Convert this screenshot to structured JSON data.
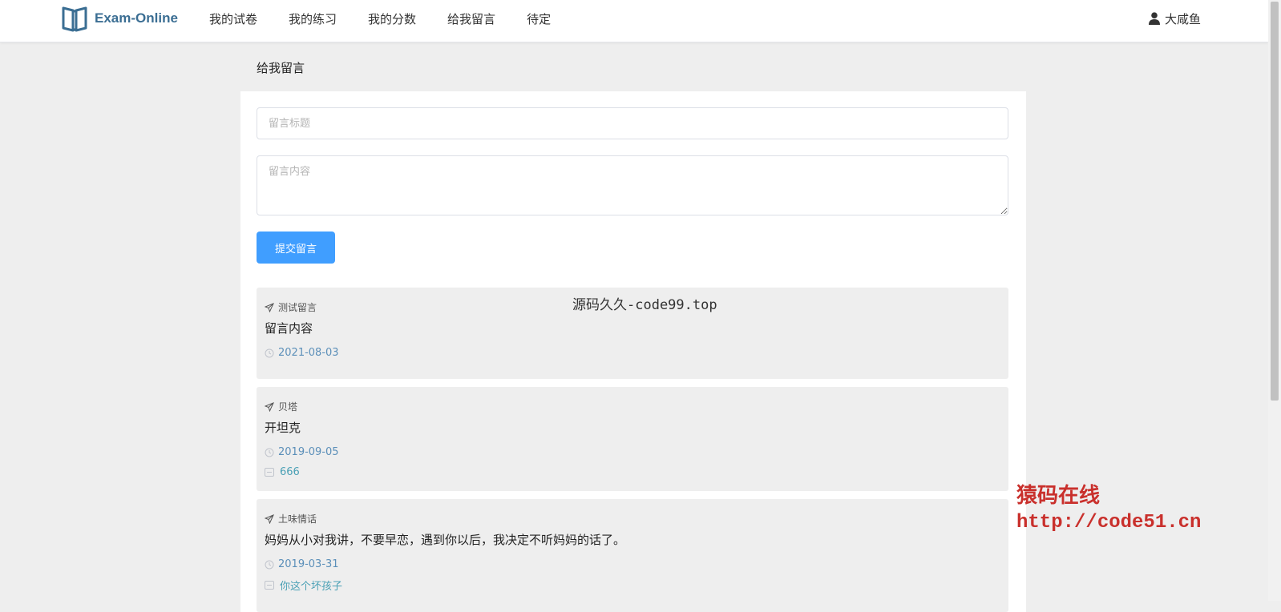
{
  "brand": {
    "name": "Exam-Online",
    "logo_icon": "open-book-icon"
  },
  "nav": {
    "items": [
      {
        "label": "我的试卷"
      },
      {
        "label": "我的练习"
      },
      {
        "label": "我的分数"
      },
      {
        "label": "给我留言"
      },
      {
        "label": "待定"
      }
    ]
  },
  "user": {
    "name": "大咸鱼",
    "icon": "user-icon"
  },
  "page": {
    "title": "给我留言"
  },
  "form": {
    "title_placeholder": "留言标题",
    "title_value": "",
    "content_placeholder": "留言内容",
    "content_value": "",
    "submit_label": "提交留言",
    "submit_color": "#409eff"
  },
  "messages": [
    {
      "title": "测试留言",
      "content": "留言内容",
      "date": "2021-08-03"
    },
    {
      "title": "贝塔",
      "content": "开坦克",
      "date": "2019-09-05",
      "reply": "666"
    },
    {
      "title": "土味情话",
      "content": "妈妈从小对我讲，不要早恋，遇到你以后，我决定不听妈妈的话了。",
      "date": "2019-03-31",
      "reply": "你这个坏孩子"
    }
  ],
  "watermarks": {
    "center": "源码久久-code99.top",
    "corner_cn": "猿码在线",
    "corner_url": "http://code51.cn",
    "corner_color": "#c9302c"
  }
}
